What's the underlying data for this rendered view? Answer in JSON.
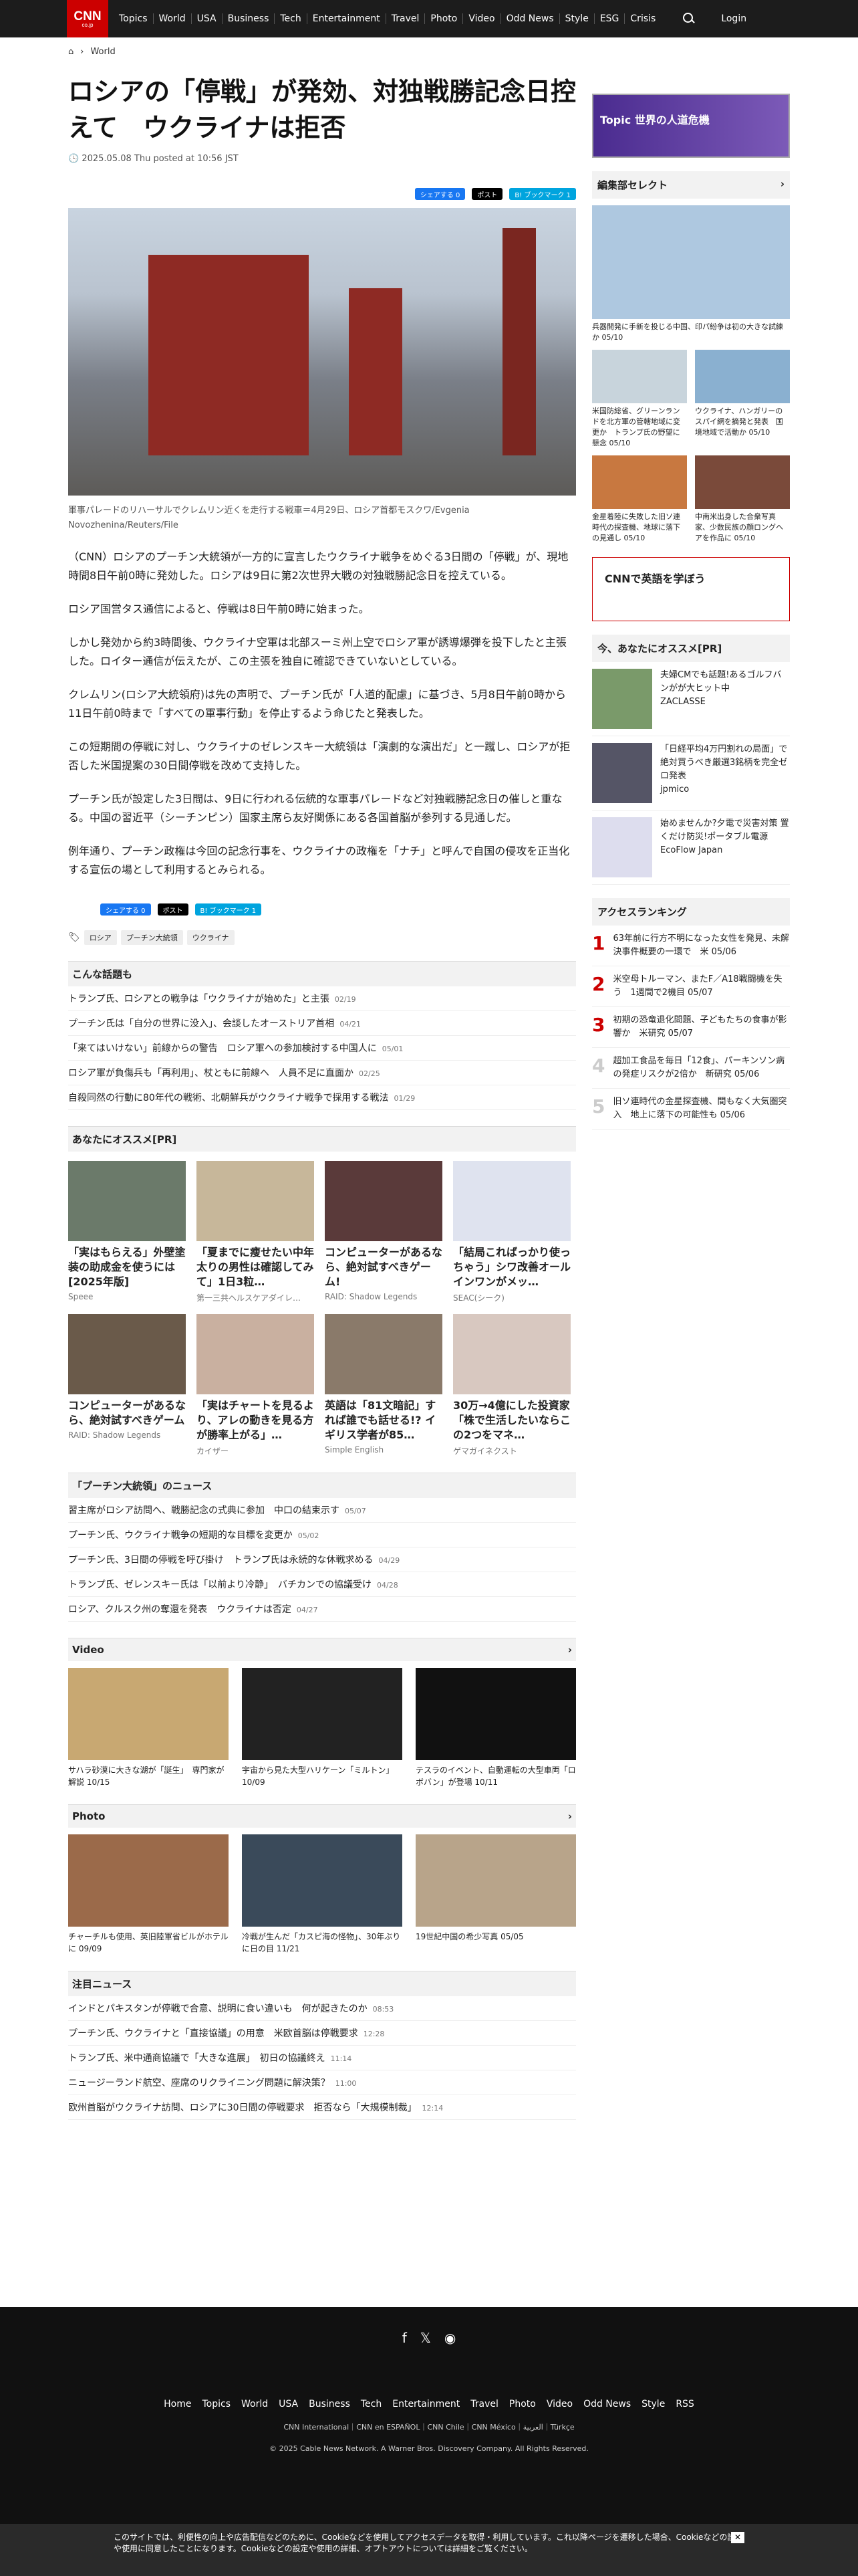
{
  "nav": {
    "logo": "CNN",
    "logo_sub": "co.jp",
    "items": [
      "Topics",
      "World",
      "USA",
      "Business",
      "Tech",
      "Entertainment",
      "Travel",
      "Photo",
      "Video",
      "Odd News",
      "Style",
      "ESG",
      "Crisis"
    ],
    "login": "Login"
  },
  "breadcrumb": {
    "home": "⌂",
    "section": "World"
  },
  "article": {
    "title": "ロシアの「停戦」が発効、対独戦勝記念日控えて　ウクライナは拒否",
    "date": "2025.05.08 Thu posted at 10:56 JST",
    "share": {
      "facebook": "シェアする 0",
      "x": "ポスト",
      "hatena": "B! ブックマーク 1"
    },
    "caption": "軍事パレードのリハーサルでクレムリン近くを走行する戦車＝4月29日、ロシア首都モスクワ/Evgenia Novozhenina/Reuters/File",
    "paragraphs": [
      "（CNN）ロシアのプーチン大統領が一方的に宣言したウクライナ戦争をめぐる3日間の「停戦」が、現地時間8日午前0時に発効した。ロシアは9日に第2次世界大戦の対独戦勝記念日を控えている。",
      "ロシア国営タス通信によると、停戦は8日午前0時に始まった。",
      "しかし発効から約3時間後、ウクライナ空軍は北部スーミ州上空でロシア軍が誘導爆弾を投下したと主張した。ロイター通信が伝えたが、この主張を独自に確認できていないとしている。",
      "クレムリン(ロシア大統領府)は先の声明で、プーチン氏が「人道的配慮」に基づき、5月8日午前0時から11日午前0時まで「すべての軍事行動」を停止するよう命じたと発表した。",
      "この短期間の停戦に対し、ウクライナのゼレンスキー大統領は「演劇的な演出だ」と一蹴し、ロシアが拒否した米国提案の30日間停戦を改めて支持した。",
      "プーチン氏が設定した3日間は、9日に行われる伝統的な軍事パレードなど対独戦勝記念日の催しと重なる。中国の習近平（シーチンピン）国家主席ら友好関係にある各国首脳が参列する見通しだ。",
      "例年通り、プーチン政権は今回の記念行事を、ウクライナの政権を「ナチ」と呼んで自国の侵攻を正当化する宣伝の場として利用するとみられる。"
    ],
    "tags": [
      "ロシア",
      "プーチン大統領",
      "ウクライナ"
    ]
  },
  "related": {
    "title": "こんな話題も",
    "items": [
      [
        "トランプ氏、ロシアとの戦争は「ウクライナが始めた」と主張",
        "02/19"
      ],
      [
        "プーチン氏は「自分の世界に没入」、会談したオーストリア首相",
        "04/21"
      ],
      [
        "「来てはいけない」前線からの警告　ロシア軍への参加検討する中国人に",
        "05/01"
      ],
      [
        "ロシア軍が負傷兵も「再利用」、杖ともに前線へ　人員不足に直面か",
        "02/25"
      ],
      [
        "自殺同然の行動に80年代の戦術、北朝鮮兵がウクライナ戦争で採用する戦法",
        "01/29"
      ]
    ]
  },
  "pr": {
    "title": "あなたにオススメ[PR]",
    "cards": [
      [
        "「実はもらえる」外壁塗装の助成金を使うには[2025年版]",
        "Speee"
      ],
      [
        "「夏までに痩せたい中年太りの男性は確認してみて」1日3粒…",
        "第一三共ヘルスケアダイレ…"
      ],
      [
        "コンピューターがあるなら、絶対試すべきゲーム!",
        "RAID: Shadow Legends"
      ],
      [
        "「結局こればっかり使っちゃう」シワ改善オールインワンがメッ…",
        "SEAC(シーク)"
      ],
      [
        "コンピューターがあるなら、絶対試すべきゲーム",
        "RAID: Shadow Legends"
      ],
      [
        "「実はチャートを見るより、アレの動きを見る方が勝率上がる」…",
        "カイザー"
      ],
      [
        "英語は「81文暗記」すれば誰でも話せる!? イギリス学者が85…",
        "Simple English"
      ],
      [
        "30万→4億にした投資家「株で生活したいならこの2つをマネ…",
        "ゲマガイネクスト"
      ]
    ]
  },
  "putin": {
    "title": "「プーチン大統領」のニュース",
    "items": [
      [
        "習主席がロシア訪問へ、戦勝記念の式典に参加　中口の結束示す",
        "05/07"
      ],
      [
        "プーチン氏、ウクライナ戦争の短期的な目標を変更か",
        "05/02"
      ],
      [
        "プーチン氏、3日間の停戦を呼び掛け　トランプ氏は永続的な休戦求める",
        "04/29"
      ],
      [
        "トランプ氏、ゼレンスキー氏は「以前より冷静」　バチカンでの協議受け",
        "04/28"
      ],
      [
        "ロシア、クルスク州の奪還を発表　ウクライナは否定",
        "04/27"
      ]
    ]
  },
  "video": {
    "title": "Video",
    "items": [
      [
        "サハラ砂漠に大きな湖が「誕生」　専門家が解説",
        "10/15"
      ],
      [
        "宇宙から見た大型ハリケーン「ミルトン」",
        "10/09"
      ],
      [
        "テスラのイベント、自動運転の大型車両「ロボバン」が登場",
        "10/11"
      ]
    ]
  },
  "photo": {
    "title": "Photo",
    "items": [
      [
        "チャーチルも使用、英旧陸軍省ビルがホテルに",
        "09/09"
      ],
      [
        "冷戦が生んだ「カスピ海の怪物」、30年ぶりに日の目",
        "11/21"
      ],
      [
        "19世紀中国の希少写真",
        "05/05"
      ]
    ]
  },
  "notable": {
    "title": "注目ニュース",
    "items": [
      [
        "インドとパキスタンが停戦で合意、説明に食い違いも　何が起きたのか",
        "08:53"
      ],
      [
        "プーチン氏、ウクライナと「直接協議」の用意　米欧首脳は停戦要求",
        "12:28"
      ],
      [
        "トランプ氏、米中通商協議で「大きな進展」　初日の協議終え",
        "11:14"
      ],
      [
        "ニュージーランド航空、座席のリクライニング問題に解決策？",
        "11:00"
      ],
      [
        "欧州首脳がウクライナ訪問、ロシアに30日間の停戦要求　拒否なら「大規模制裁」",
        "12:14"
      ]
    ]
  },
  "sidebar": {
    "topic": "Topic 世界の人道危機",
    "editor": "編集部セレクト",
    "editor_items": [
      [
        "兵器開発に手新を投じる中国、印パ紛争は初の大きな試練か",
        "05/10"
      ],
      [
        "米国防総省、グリーンランドを北方軍の管轄地域に変更か　トランプ氏の野望に懸念",
        "05/10"
      ],
      [
        "ウクライナ、ハンガリーのスパイ網を摘発と発表　国境地域で活動か",
        "05/10"
      ],
      [
        "金星着陸に失敗した旧ソ連時代の探査機、地球に落下の見通し",
        "05/10"
      ],
      [
        "中南米出身した合衆写真家、少数民族の顔ロングヘアを作品に",
        "05/10"
      ]
    ],
    "english": "CNNで英語を学ぼう",
    "pr_title": "今、あなたにオススメ[PR]",
    "pr_items": [
      [
        "夫婦CMでも話題!あるゴルフバンがが大ヒット中",
        "ZACLASSE"
      ],
      [
        "「日経平均4万円割れの局面」で絶対買うべき厳選3銘柄を完全ゼロ発表",
        "jpmico"
      ],
      [
        "始めませんか?夕電で災害対策 置くだけ防災!ポータブル電源",
        "EcoFlow Japan"
      ]
    ],
    "ranking_title": "アクセスランキング",
    "ranking": [
      [
        "63年前に行方不明になった女性を発見、未解決事件概要の一環で　米",
        "05/06"
      ],
      [
        "米空母トルーマン、またF／A18戦闘機を失う　1週間で2機目",
        "05/07"
      ],
      [
        "初期の恐竜退化問題、子どもたちの食事が影響か　米研究",
        "05/07"
      ],
      [
        "超加工食品を毎日「12食」、パーキンソン病の発症リスクが2倍か　新研究",
        "05/06"
      ],
      [
        "旧ソ連時代の金星探査機、間もなく大気圏突入　地上に落下の可能性も",
        "05/06"
      ]
    ]
  },
  "footer": {
    "links": [
      "Home",
      "Topics",
      "World",
      "USA",
      "Business",
      "Tech",
      "Entertainment",
      "Travel",
      "Photo",
      "Video",
      "Odd News",
      "Style",
      "RSS"
    ],
    "sub": "CNN International｜CNN en ESPAÑOL｜CNN Chile｜CNN México｜العربية｜Türkçe",
    "copyright": "© 2025 Cable News Network. A Warner Bros. Discovery Company. All Rights Reserved."
  },
  "cookie": "このサイトでは、利便性の向上や広告配信などのために、Cookieなどを使用してアクセスデータを取得・利用しています。これ以降ページを遷移した場合、Cookieなどの設定や使用に同意したことになります。Cookieなどの設定や使用の詳細、オプトアウトについては詳細をご覧ください。"
}
